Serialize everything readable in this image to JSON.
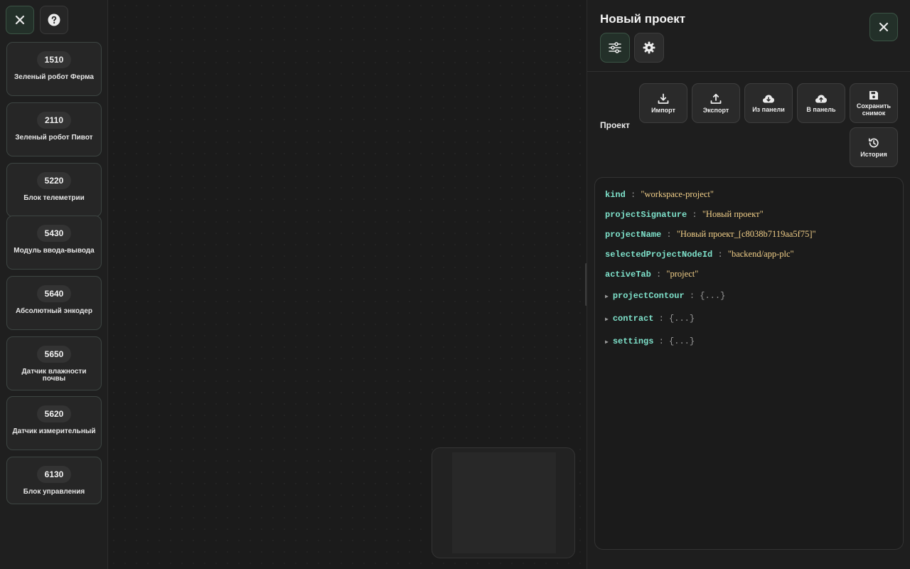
{
  "sidebar": {
    "close_icon": "close-icon",
    "help_icon": "help-icon",
    "nodes": [
      {
        "id": "1510",
        "label": "Зеленый робот Ферма"
      },
      {
        "id": "2110",
        "label": "Зеленый робот Пивот"
      },
      {
        "id": "5220",
        "label": "Блок телеметрии"
      },
      {
        "id": "5430",
        "label": "Модуль ввода-вывода"
      },
      {
        "id": "5640",
        "label": "Абсолютный энкодер"
      },
      {
        "id": "5650",
        "label": "Датчик влажности почвы"
      },
      {
        "id": "5620",
        "label": "Датчик измерительный"
      },
      {
        "id": "6130",
        "label": "Блок управления"
      }
    ]
  },
  "panel": {
    "title": "Новый проект",
    "section_label": "Проект",
    "actions": {
      "import": "Импорт",
      "export": "Экспорт",
      "from_panel": "Из панели",
      "to_panel": "В панель",
      "save_snapshot": "Сохранить снимок",
      "history": "История"
    },
    "json": {
      "kind_key": "kind",
      "kind_val": "\"workspace-project\"",
      "sig_key": "projectSignature",
      "sig_val": "\"Новый проект\"",
      "name_key": "projectName",
      "name_val": "\"Новый проект_[c8038b7119aa5f75]\"",
      "node_key": "selectedProjectNodeId",
      "node_val": "\"backend/app-plc\"",
      "tab_key": "activeTab",
      "tab_val": "\"project\"",
      "contour_key": "projectContour",
      "contract_key": "contract",
      "settings_key": "settings",
      "collapsed": "{...}",
      "colon": ":"
    }
  },
  "colors": {
    "accent_green": "#3b5445",
    "json_key": "#7fe3cc",
    "json_string": "#f3d089"
  }
}
